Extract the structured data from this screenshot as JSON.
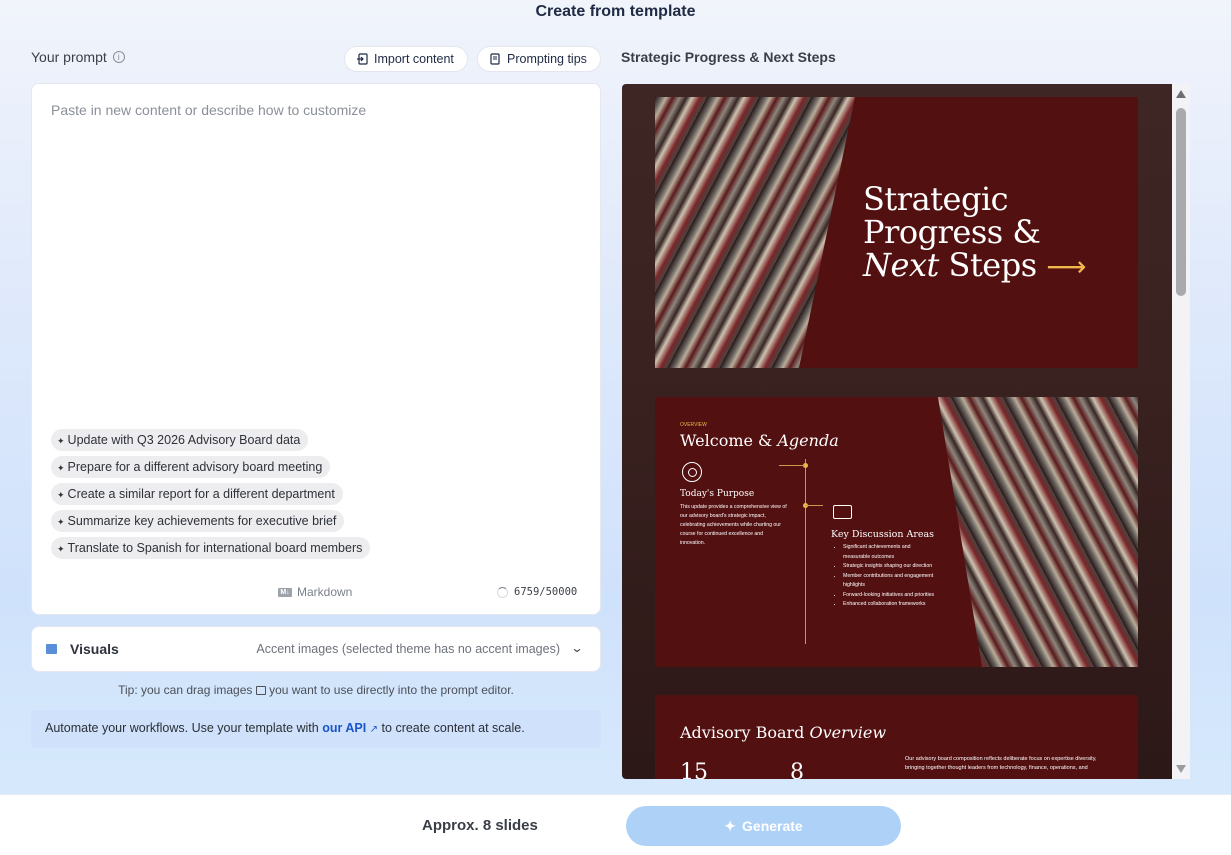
{
  "header": {
    "title": "Create from template"
  },
  "prompt": {
    "label": "Your prompt",
    "info_icon": "info-icon",
    "import_label": "Import content",
    "tips_label": "Prompting tips",
    "placeholder": "Paste in new content or describe how to customize",
    "value": "",
    "suggestions": [
      "Update with Q3 2026 Advisory Board data",
      "Prepare for a different advisory board meeting",
      "Create a similar report for a different department",
      "Summarize key achievements for executive brief",
      "Translate to Spanish for international board members"
    ],
    "format_label": "Markdown",
    "char_count": "6759/50000"
  },
  "visuals": {
    "label": "Visuals",
    "value": "Accent images (selected theme has no accent images)"
  },
  "tip": {
    "before": "Tip: you can drag images",
    "after": "you want to use directly into the prompt editor."
  },
  "api_banner": {
    "before": "Automate your workflows. Use your template with",
    "link": "our API",
    "after": "to create content at scale."
  },
  "preview": {
    "title": "Strategic Progress & Next Steps",
    "slide1": {
      "line1": "Strategic",
      "line2": "Progress &",
      "italic": "Next",
      "line3_rest": " Steps"
    },
    "slide2": {
      "eyebrow": "OVERVIEW",
      "title_plain": "Welcome & ",
      "title_italic": "Agenda",
      "purpose_heading": "Today's Purpose",
      "purpose_body": "This update provides a comprehensive view of our advisory board's strategic impact, celebrating achievements while charting our course for continued excellence and innovation.",
      "key_heading": "Key Discussion Areas",
      "key_items": [
        "Significant achievements and measurable outcomes",
        "Strategic insights shaping our direction",
        "Member contributions and engagement highlights",
        "Forward-looking initiatives and priorities",
        "Enhanced collaboration frameworks"
      ]
    },
    "slide3": {
      "title_plain": "Advisory Board ",
      "title_italic": "Overview",
      "stat1": "15",
      "stat2": "8",
      "desc": "Our advisory board composition reflects deliberate focus on expertise diversity, bringing together thought leaders from technology, finance, operations, and"
    }
  },
  "footer": {
    "slides_count": "Approx. 8 slides",
    "generate_label": "Generate"
  },
  "colors": {
    "accent": "#1a56c9",
    "slide_bg": "#531011",
    "gold": "#f0b84a",
    "generate_disabled": "#aed1f8"
  }
}
